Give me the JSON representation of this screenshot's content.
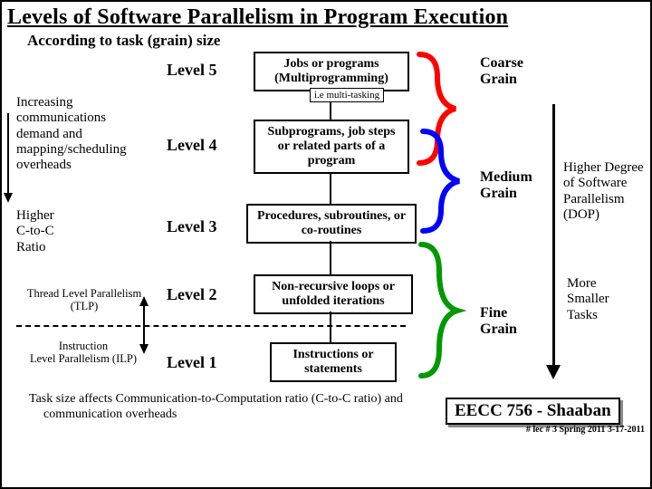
{
  "title": "Levels of Software Parallelism in Program Execution",
  "subtitle": "According to task (grain) size",
  "levels": {
    "l5": "Level 5",
    "l4": "Level 4",
    "l3": "Level 3",
    "l2": "Level 2",
    "l1": "Level 1"
  },
  "boxes": {
    "b5": "Jobs or programs (Multiprogramming)",
    "b5note": "i.e multi-tasking",
    "b4": "Subprograms, job steps or related parts of a program",
    "b3": "Procedures, subroutines, or co-routines",
    "b2": "Non-recursive loops or unfolded iterations",
    "b1": "Instructions or statements"
  },
  "left_labels": {
    "comm": "Increasing communications demand and mapping/scheduling overheads",
    "ctoc": "Higher\nC-to-C\nRatio",
    "tlp": "Thread Level Parallelism\n(TLP)",
    "ilp": "Instruction\nLevel Parallelism (ILP)"
  },
  "grains": {
    "coarse": "Coarse Grain",
    "medium": "Medium Grain",
    "fine": "Fine Grain"
  },
  "right_notes": {
    "dop": "Higher Degree of Software Parallelism (DOP)",
    "smaller": "More Smaller Tasks"
  },
  "bottom_note": "Task size affects Communication-to-Computation ratio (C-to-C ratio) and communication overheads",
  "course": "EECC 756 - Shaaban",
  "footer": "#  lec # 3   Spring 2011  3-17-2011",
  "colors": {
    "red": "#ff0000",
    "blue": "#0000ff",
    "green": "#009900"
  }
}
